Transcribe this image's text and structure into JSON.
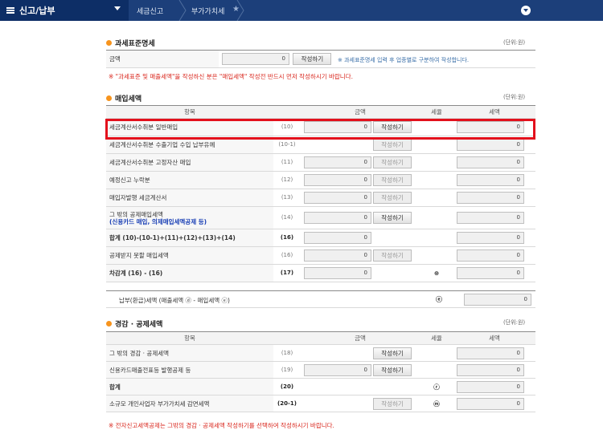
{
  "nav": {
    "menu_title": "신고/납부",
    "crumbs": [
      "세금신고",
      "부가가치세"
    ]
  },
  "tax_base": {
    "title": "과세표준명세",
    "unit": "(단위:원)",
    "amount_label": "금액",
    "amount_value": "0",
    "button": "작성하기",
    "info": "과세표준명세 입력 후 업종별로 구분하여 작성합니다.",
    "note": "※ \"과세표준 및 매출세액\"을 작성하신 분은 \"매입세액\" 작성전 반드시 먼저 작성하시기 바랍니다."
  },
  "purchase": {
    "title": "매입세액",
    "unit": "(단위:원)",
    "headers": [
      "항목",
      "금액",
      "세율",
      "세액"
    ],
    "rows": [
      {
        "label": "세금계산서수취분 일반매입",
        "code": "(10)",
        "amount": "0",
        "button": "작성하기",
        "tax": "0"
      },
      {
        "label": "세금계산서수취분 수출기업 수입 납부유예",
        "code": "(10-1)",
        "amount": "",
        "button": "작성하기",
        "tax": "0"
      },
      {
        "label": "세금계산서수취분 고정자산 매입",
        "code": "(11)",
        "amount": "0",
        "button": "작성하기",
        "tax": "0"
      },
      {
        "label": "예정신고 누락분",
        "code": "(12)",
        "amount": "0",
        "button": "작성하기",
        "tax": "0"
      },
      {
        "label": "매입자발행 세금계산서",
        "code": "(13)",
        "amount": "0",
        "button": "작성하기",
        "tax": "0"
      },
      {
        "label": "그 밖의 공제매입세액",
        "sub": "(신용카드 매입, 의제매입세액공제 등)",
        "code": "(14)",
        "amount": "0",
        "button": "작성하기",
        "tax": "0"
      },
      {
        "label": "합계 (10)-(10-1)+(11)+(12)+(13)+(14)",
        "code": "(16)",
        "amount": "0",
        "button": "",
        "tax": "0"
      },
      {
        "label": "공제받지 못할 매입세액",
        "code": "(16)",
        "amount": "0",
        "button": "작성하기",
        "tax": "0"
      },
      {
        "label": "차감계 (16) - (16)",
        "code": "(17)",
        "amount": "0",
        "rate": "⊕",
        "button": "",
        "tax": "0"
      }
    ]
  },
  "net": {
    "label": "납부(환급)세액 (매출세액 ⓓ - 매입세액 ⓔ)",
    "circle": "ⓔ",
    "value": "0"
  },
  "deduction": {
    "title": "경감 · 공제세액",
    "unit": "(단위:원)",
    "headers": [
      "항목",
      "금액",
      "세율",
      "세액"
    ],
    "rows": [
      {
        "label": "그 밖의 경감 · 공제세액",
        "code": "(18)",
        "amount": "",
        "button": "작성하기",
        "rate": "",
        "tax": "0"
      },
      {
        "label": "신용카드매출전표등 발행공제 등",
        "code": "(19)",
        "amount": "0",
        "button": "작성하기",
        "rate": "",
        "tax": "0"
      },
      {
        "label": "합계",
        "code": "(20)",
        "amount": "",
        "button": "",
        "rate": "ⓡ",
        "tax": "0"
      },
      {
        "label": "소규모 개인사업자 부가가치세 감면세액",
        "code": "(20-1)",
        "amount": "",
        "button": "작성하기",
        "rate": "ⓜ",
        "tax": "0"
      }
    ],
    "note": "※ 전자신고세액공제는 그밖의 경감 · 공제세액 작성하기를 선택하여 작성하시기 바랍니다."
  }
}
